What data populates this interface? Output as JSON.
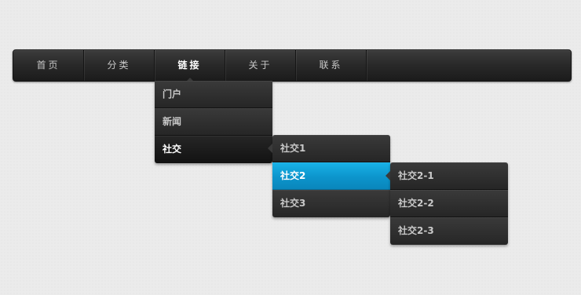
{
  "nav": {
    "items": [
      {
        "label": "首页",
        "active": false
      },
      {
        "label": "分类",
        "active": false
      },
      {
        "label": "链接",
        "active": true
      },
      {
        "label": "关于",
        "active": false
      },
      {
        "label": "联系",
        "active": false
      }
    ]
  },
  "menu_level1": {
    "items": [
      {
        "label": "门户"
      },
      {
        "label": "新闻"
      },
      {
        "label": "社交",
        "state": "open"
      }
    ]
  },
  "menu_level2": {
    "items": [
      {
        "label": "社交1"
      },
      {
        "label": "社交2",
        "state": "highlighted"
      },
      {
        "label": "社交3"
      }
    ]
  },
  "menu_level3": {
    "items": [
      {
        "label": "社交2-1"
      },
      {
        "label": "社交2-2"
      },
      {
        "label": "社交2-3"
      }
    ]
  },
  "colors": {
    "bar_dark": "#1b1b1b",
    "highlight_blue": "#0c95cc",
    "text_light": "#c9c9c9",
    "page_bg": "#ebebeb"
  }
}
